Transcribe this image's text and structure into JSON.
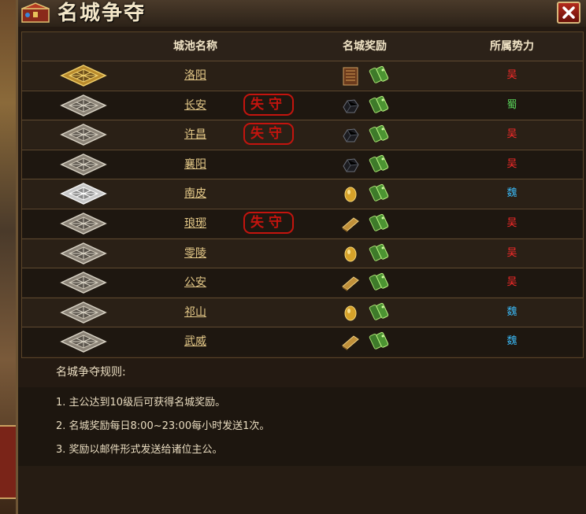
{
  "window": {
    "title": "名城争夺"
  },
  "table": {
    "headers": {
      "city": "城池名称",
      "reward": "名城奖励",
      "faction": "所属势力"
    },
    "rows": [
      {
        "city": "洛阳",
        "lost": false,
        "city_icon": "gold-city-map-icon",
        "reward": "book-icon",
        "faction": "吴",
        "faction_color": "#ff2a2a"
      },
      {
        "city": "长安",
        "lost": true,
        "city_icon": "city-map-icon",
        "reward": "black-ore-icon",
        "faction": "蜀",
        "faction_color": "#59d55a"
      },
      {
        "city": "许昌",
        "lost": true,
        "city_icon": "city-map-icon",
        "reward": "black-ore-icon",
        "faction": "吴",
        "faction_color": "#ff2a2a"
      },
      {
        "city": "襄阳",
        "lost": false,
        "city_icon": "city-map-icon",
        "reward": "black-ore-icon",
        "faction": "吴",
        "faction_color": "#ff2a2a"
      },
      {
        "city": "南皮",
        "lost": false,
        "city_icon": "silver-city-map-icon",
        "reward": "gold-nugget-icon",
        "faction": "魏",
        "faction_color": "#3ab8f5"
      },
      {
        "city": "琅琊",
        "lost": true,
        "city_icon": "city-map-icon",
        "reward": "gold-bar-icon",
        "faction": "吴",
        "faction_color": "#ff2a2a"
      },
      {
        "city": "零陵",
        "lost": false,
        "city_icon": "city-map-icon",
        "reward": "gold-nugget-icon",
        "faction": "吴",
        "faction_color": "#ff2a2a"
      },
      {
        "city": "公安",
        "lost": false,
        "city_icon": "city-map-icon",
        "reward": "gold-bar-icon",
        "faction": "吴",
        "faction_color": "#ff2a2a"
      },
      {
        "city": "祁山",
        "lost": false,
        "city_icon": "city-map-icon",
        "reward": "gold-nugget-icon",
        "faction": "魏",
        "faction_color": "#3ab8f5"
      },
      {
        "city": "武威",
        "lost": false,
        "city_icon": "city-map-icon",
        "reward": "gold-bar-icon",
        "faction": "魏",
        "faction_color": "#3ab8f5"
      }
    ],
    "lost_label": "失守",
    "second_reward": "green-jade-icon"
  },
  "rules": {
    "title": "名城争夺规则:",
    "items": [
      "1. 主公达到10级后可获得名城奖励。",
      "2. 名城奖励每日8:00~23:00每小时发送1次。",
      "3. 奖励以邮件形式发送给诸位主公。"
    ]
  }
}
